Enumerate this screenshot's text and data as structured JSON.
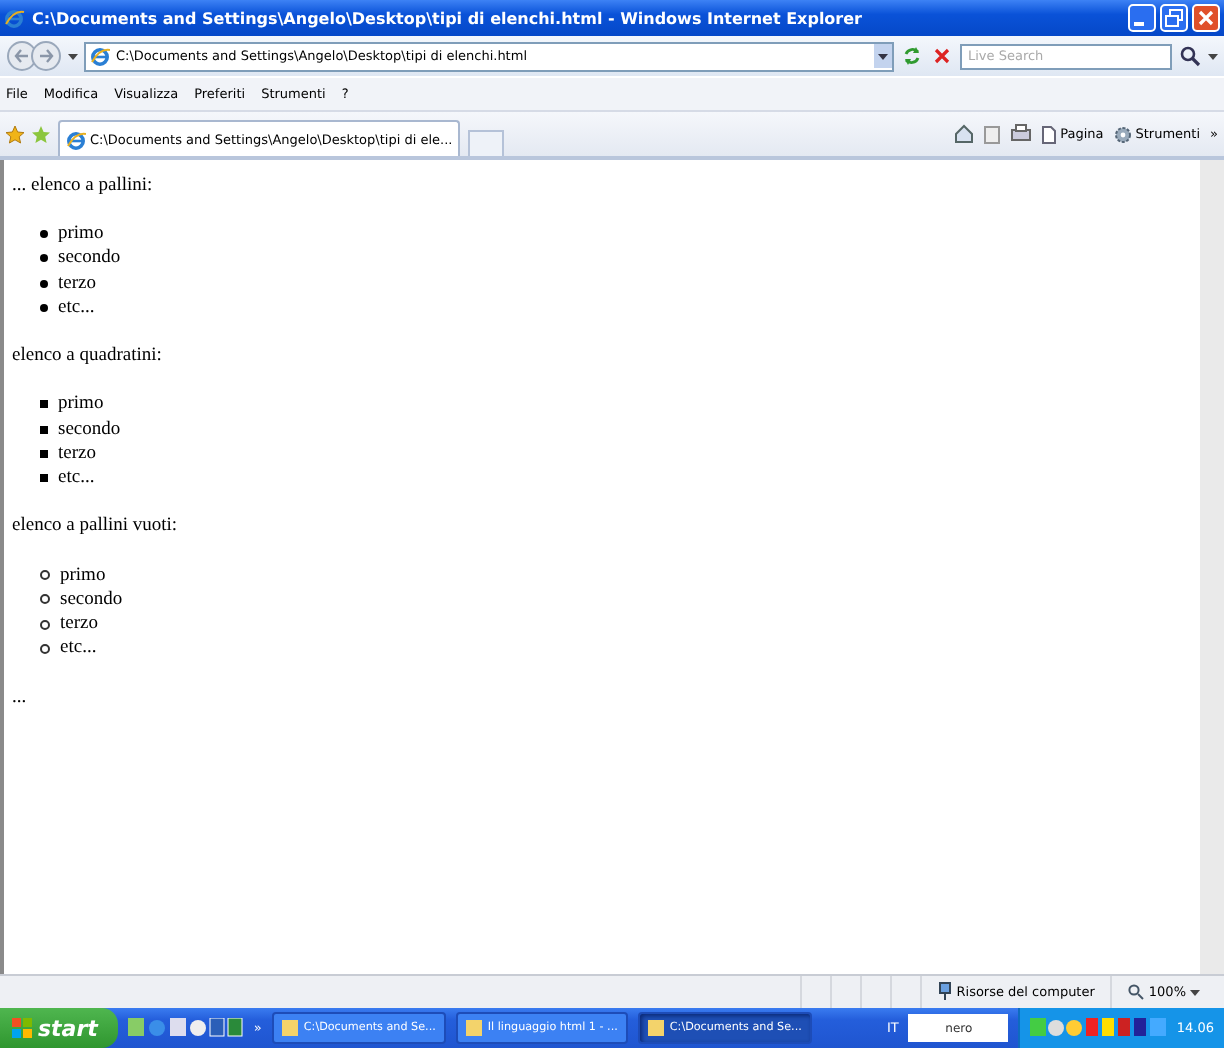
{
  "window": {
    "title": "C:\\Documents and Settings\\Angelo\\Desktop\\tipi di elenchi.html - Windows Internet Explorer"
  },
  "address_bar": {
    "url": "C:\\Documents and Settings\\Angelo\\Desktop\\tipi di elenchi.html"
  },
  "search": {
    "placeholder": "Live Search"
  },
  "menu": [
    "File",
    "Modifica",
    "Visualizza",
    "Preferiti",
    "Strumenti",
    "?"
  ],
  "tabs": [
    {
      "label": "C:\\Documents and Settings\\Angelo\\Desktop\\tipi di ele...",
      "selected": true
    }
  ],
  "command_bar": {
    "page_label": "Pagina",
    "tools_label": "Strumenti",
    "more": "»"
  },
  "content": [
    {
      "kind": "paragraph",
      "text": "... elenco a pallini:"
    },
    {
      "kind": "disc",
      "items": [
        "primo",
        "secondo",
        "terzo",
        "etc..."
      ]
    },
    {
      "kind": "paragraph",
      "text": "elenco a quadratini:"
    },
    {
      "kind": "square",
      "items": [
        "primo",
        "secondo",
        "terzo",
        "etc..."
      ]
    },
    {
      "kind": "paragraph",
      "text": "elenco a pallini vuoti:"
    },
    {
      "kind": "circle",
      "items": [
        "primo",
        "secondo",
        "terzo",
        "etc..."
      ]
    },
    {
      "kind": "paragraph",
      "text": "..."
    }
  ],
  "status_bar": {
    "zone": "Risorse del computer",
    "zoom": "100%"
  },
  "taskbar": {
    "start": "start",
    "more": "»",
    "tasks": [
      {
        "label": "C:\\Documents and Se...",
        "selected": false
      },
      {
        "label": "Il linguaggio html 1 - ...",
        "selected": false
      },
      {
        "label": "C:\\Documents and Se...",
        "selected": true
      }
    ],
    "language": "IT",
    "nero": "nero",
    "clock": "14.06"
  }
}
